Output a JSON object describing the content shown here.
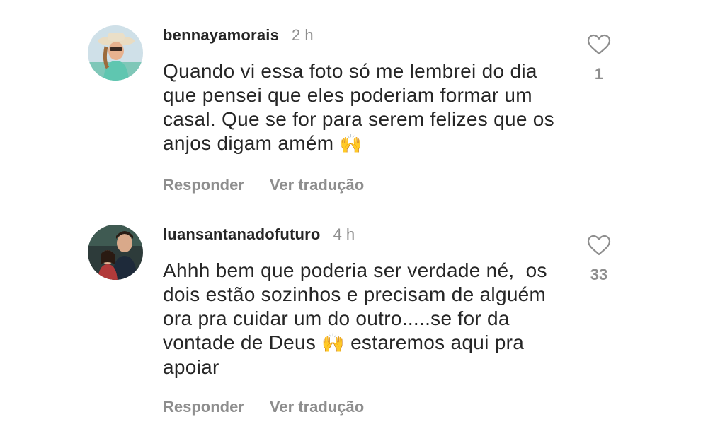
{
  "comments": [
    {
      "username": "bennayamorais",
      "time": "2 h",
      "text_before_emoji": "Quando vi essa foto só me lembrei do dia\nque pensei que eles poderiam formar um\ncasal. Que se for para serem felizes que os\nanjos digam amém ",
      "emoji": "🙌",
      "text_after_emoji": "",
      "likes": "1",
      "reply_label": "Responder",
      "translate_label": "Ver tradução",
      "avatar_icon": "profile-photo-woman-hat",
      "heart_icon": "heart-outline-icon"
    },
    {
      "username": "luansantanadofuturo",
      "time": "4 h",
      "text_before_emoji": "Ahhh bem que poderia ser verdade né,  os\ndois estão sozinhos e precisam de alguém\nora pra cuidar um do outro.....se for da\nvontade de Deus ",
      "emoji": "🙌",
      "text_after_emoji": " estaremos aqui pra\napoiar",
      "likes": "33",
      "reply_label": "Responder",
      "translate_label": "Ver tradução",
      "avatar_icon": "profile-photo-two-people",
      "heart_icon": "heart-outline-icon"
    }
  ],
  "colors": {
    "text": "#262626",
    "secondary": "#8e8e8e",
    "emoji": "#f2b233"
  }
}
